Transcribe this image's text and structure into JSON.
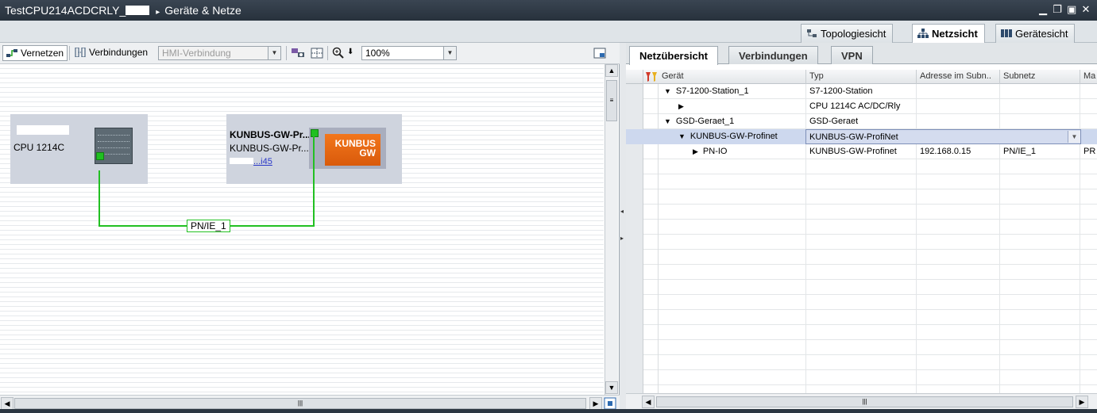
{
  "title": {
    "project": "TestCPU214ACDCRLY_",
    "separator": "▸",
    "page": "Geräte & Netze"
  },
  "window_controls": {
    "minimize": "▁",
    "restore": "❐",
    "maximize": "▣",
    "close": "✕"
  },
  "view_tabs": [
    {
      "label": "Topologiesicht",
      "icon": "topology-icon"
    },
    {
      "label": "Netzsicht",
      "icon": "network-icon"
    },
    {
      "label": "Gerätesicht",
      "icon": "device-icon"
    }
  ],
  "toolbar": {
    "network_button": "Vernetzen",
    "connections_label": "Verbindungen",
    "connection_type": "HMI-Verbindung",
    "zoom": "100%",
    "dropdown_arrow": "▼",
    "zoom_down_arrow": "⬇"
  },
  "canvas": {
    "cpu_device": {
      "label": "CPU 1214C"
    },
    "gateway_device": {
      "name": "KUNBUS-GW-Pr...",
      "type": "KUNBUS-GW-Pr...",
      "link": "...i45",
      "logo_line1": "KUNBUS",
      "logo_line2": "GW"
    },
    "subnet_label": "PN/IE_1"
  },
  "scroll_glyphs": {
    "up": "▲",
    "down": "▼",
    "left": "◀",
    "right": "▶",
    "grip": "|||",
    "grip_h": "≡",
    "split_left": "◂",
    "split_right": "▸"
  },
  "overview_tabs": [
    "Netzübersicht",
    "Verbindungen",
    "VPN"
  ],
  "grid": {
    "headers": [
      "Gerät",
      "Typ",
      "Adresse im Subn..",
      "Subnetz",
      "Ma"
    ],
    "rows": [
      {
        "expander": "▼",
        "device": "S7-1200-Station_1",
        "type": "S7-1200-Station",
        "address": "",
        "subnet": "",
        "extra": ""
      },
      {
        "expander": "▶",
        "device": "",
        "type": "CPU 1214C AC/DC/Rly",
        "address": "",
        "subnet": "",
        "extra": ""
      },
      {
        "expander": "▼",
        "device": "GSD-Geraet_1",
        "type": "GSD-Geraet",
        "address": "",
        "subnet": "",
        "extra": ""
      },
      {
        "expander": "▼",
        "device": "KUNBUS-GW-Profinet",
        "type": "KUNBUS-GW-ProfiNet",
        "address": "",
        "subnet": "",
        "extra": ""
      },
      {
        "expander": "▶",
        "device": "PN-IO",
        "type": "KUNBUS-GW-Profinet",
        "address": "192.168.0.15",
        "subnet": "PN/IE_1",
        "extra": "PR"
      }
    ]
  },
  "colors": {
    "title_bar": "#2f3a46",
    "net_line": "#22c022",
    "gateway_logo": "#e8660f",
    "selection": "#cdd8ee"
  }
}
